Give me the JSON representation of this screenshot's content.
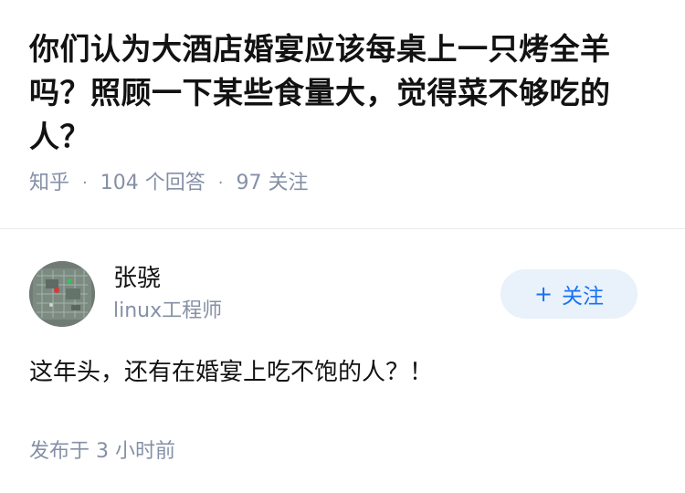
{
  "question": {
    "title": "你们认为大酒店婚宴应该每桌上一只烤全羊吗？照顾一下某些食量大，觉得菜不够吃的人？",
    "source": "知乎",
    "answers": "104 个回答",
    "followers": "97 关注"
  },
  "answer": {
    "author_name": "张骁",
    "author_bio": "linux工程师",
    "follow_label": "关注",
    "follow_icon": "plus-icon",
    "content": "这年头，还有在婚宴上吃不饱的人？！",
    "published": "发布于 3 小时前"
  },
  "colors": {
    "text": "#121212",
    "muted": "#8590a6",
    "accent": "#1772f6",
    "button_bg": "#e9f1fa"
  }
}
